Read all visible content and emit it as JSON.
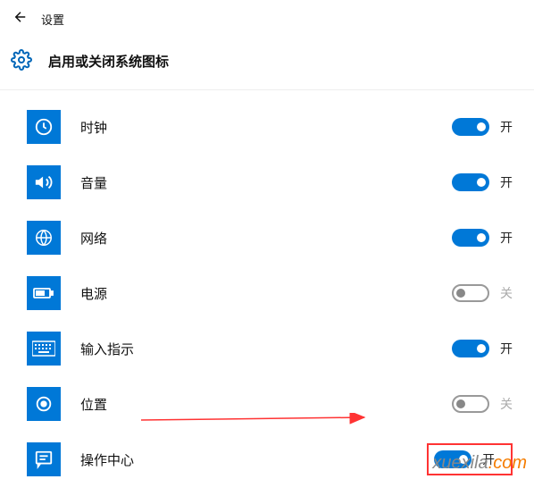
{
  "header": {
    "title": "设置",
    "page_title": "启用或关闭系统图标"
  },
  "items": [
    {
      "icon": "clock",
      "label": "时钟",
      "state": true,
      "state_label": "开"
    },
    {
      "icon": "volume",
      "label": "音量",
      "state": true,
      "state_label": "开"
    },
    {
      "icon": "network",
      "label": "网络",
      "state": true,
      "state_label": "开"
    },
    {
      "icon": "power",
      "label": "电源",
      "state": false,
      "state_label": "关"
    },
    {
      "icon": "input",
      "label": "输入指示",
      "state": true,
      "state_label": "开"
    },
    {
      "icon": "location",
      "label": "位置",
      "state": false,
      "state_label": "关"
    },
    {
      "icon": "action-center",
      "label": "操作中心",
      "state": true,
      "state_label": "开",
      "highlight": true
    }
  ],
  "watermark": {
    "main": "xuexila",
    "suffix": ".com"
  }
}
